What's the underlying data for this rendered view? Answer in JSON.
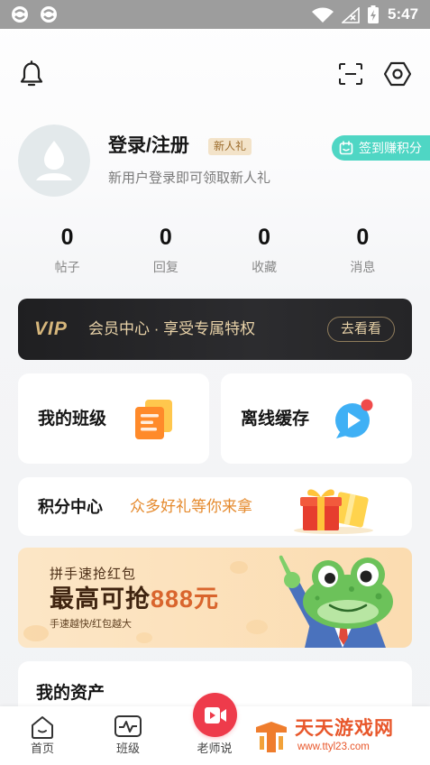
{
  "status_bar": {
    "time": "5:47",
    "icons": [
      "app-notification-icon",
      "app-notification-icon",
      "wifi-icon",
      "signal-icon",
      "battery-icon"
    ]
  },
  "header": {
    "icons": [
      "bell-icon",
      "scan-icon",
      "settings-icon"
    ]
  },
  "profile": {
    "name": "登录/注册",
    "badge": "新人礼",
    "subtitle": "新用户登录即可领取新人礼",
    "checkin_label": "签到赚积分",
    "avatar_icon": "default-avatar-icon"
  },
  "stats": [
    {
      "value": "0",
      "label": "帖子"
    },
    {
      "value": "0",
      "label": "回复"
    },
    {
      "value": "0",
      "label": "收藏"
    },
    {
      "value": "0",
      "label": "消息"
    }
  ],
  "vip": {
    "logo": "VIP",
    "text": "会员中心 · 享受专属特权",
    "button": "去看看"
  },
  "shortcuts": [
    {
      "label": "我的班级",
      "icon": "document-icon"
    },
    {
      "label": "离线缓存",
      "icon": "play-icon"
    }
  ],
  "points": {
    "title": "积分中心",
    "tagline": "众多好礼等你来拿",
    "icon": "gift-icon"
  },
  "red_packet": {
    "title": "拼手速抢红包",
    "headline_prefix": "最高可抢",
    "headline_amount": "888元",
    "caption": "手速越快/红包越大",
    "illustration": "frog-mascot"
  },
  "assets": {
    "title": "我的资产"
  },
  "bottom_nav": [
    {
      "label": "首页",
      "icon": "home-icon"
    },
    {
      "label": "班级",
      "icon": "pulse-icon"
    },
    {
      "label": "老师说",
      "icon": "video-icon"
    }
  ],
  "watermark": {
    "name": "天天游戏网",
    "url": "www.ttyl23.com"
  },
  "colors": {
    "status_bar": "#9d9d9d",
    "checkin_teal": "#4fd6c4",
    "vip_background": "#242426",
    "vip_gold": "#d7b77c",
    "points_orange": "#e58a2d",
    "red_packet_background": "#fbe2c0",
    "teacher_red": "#ee3b4b",
    "watermark_orange": "#e8572b"
  }
}
